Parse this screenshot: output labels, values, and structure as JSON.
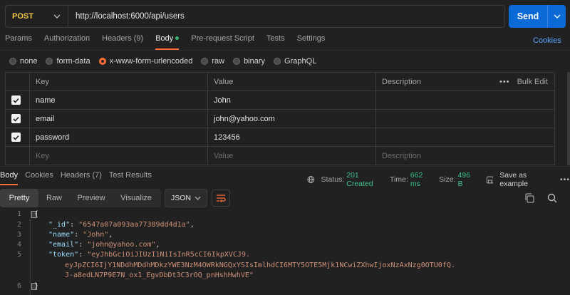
{
  "request": {
    "method": "POST",
    "url": "http://localhost:6000/api/users",
    "send_label": "Send"
  },
  "request_tabs": [
    "Params",
    "Authorization",
    "Headers (9)",
    "Body",
    "Pre-request Script",
    "Tests",
    "Settings"
  ],
  "cookies_link": "Cookies",
  "body_types": [
    "none",
    "form-data",
    "x-www-form-urlencoded",
    "raw",
    "binary",
    "GraphQL"
  ],
  "params_table": {
    "headers": {
      "key": "Key",
      "value": "Value",
      "description": "Description",
      "bulk_edit": "Bulk Edit"
    },
    "rows": [
      {
        "key": "name",
        "value": "John"
      },
      {
        "key": "email",
        "value": "john@yahoo.com"
      },
      {
        "key": "password",
        "value": "123456"
      }
    ],
    "placeholders": {
      "key": "Key",
      "value": "Value",
      "description": "Description"
    }
  },
  "response_tabs": [
    "Body",
    "Cookies",
    "Headers (7)",
    "Test Results"
  ],
  "response_status": {
    "status_label": "Status:",
    "status_value": "201 Created",
    "time_label": "Time:",
    "time_value": "662 ms",
    "size_label": "Size:",
    "size_value": "496 B",
    "save_label": "Save as example"
  },
  "view_modes": [
    "Pretty",
    "Raw",
    "Preview",
    "Visualize"
  ],
  "format": "JSON",
  "code_lines": {
    "l1": "{",
    "id_key": "\"_id\"",
    "id_val": "\"6547a07a093aa77389dd4d1a\"",
    "name_key": "\"name\"",
    "name_val": "\"John\"",
    "email_key": "\"email\"",
    "email_val": "\"john@yahoo.com\"",
    "token_key": "\"token\"",
    "token_1": "\"eyJhbGciOiJIUzI1NiIsInR5cCI6IkpXVCJ9.",
    "token_2": "eyJpZCI6IjY1NDdhMDdhMDkzYWE3NzM4OWRkNGQxYSIsImlhdCI6MTY5OTE5Mjk1NCwiZXhwIjoxNzAxNzg0OTU0fQ.",
    "token_3": "J-a8edLN7P9E7N_ox1_EgvDbDt3C3rOQ_pnHshHwhVE\"",
    "l6": "}"
  },
  "line_numbers": [
    "1",
    "2",
    "3",
    "4",
    "5",
    "6"
  ]
}
